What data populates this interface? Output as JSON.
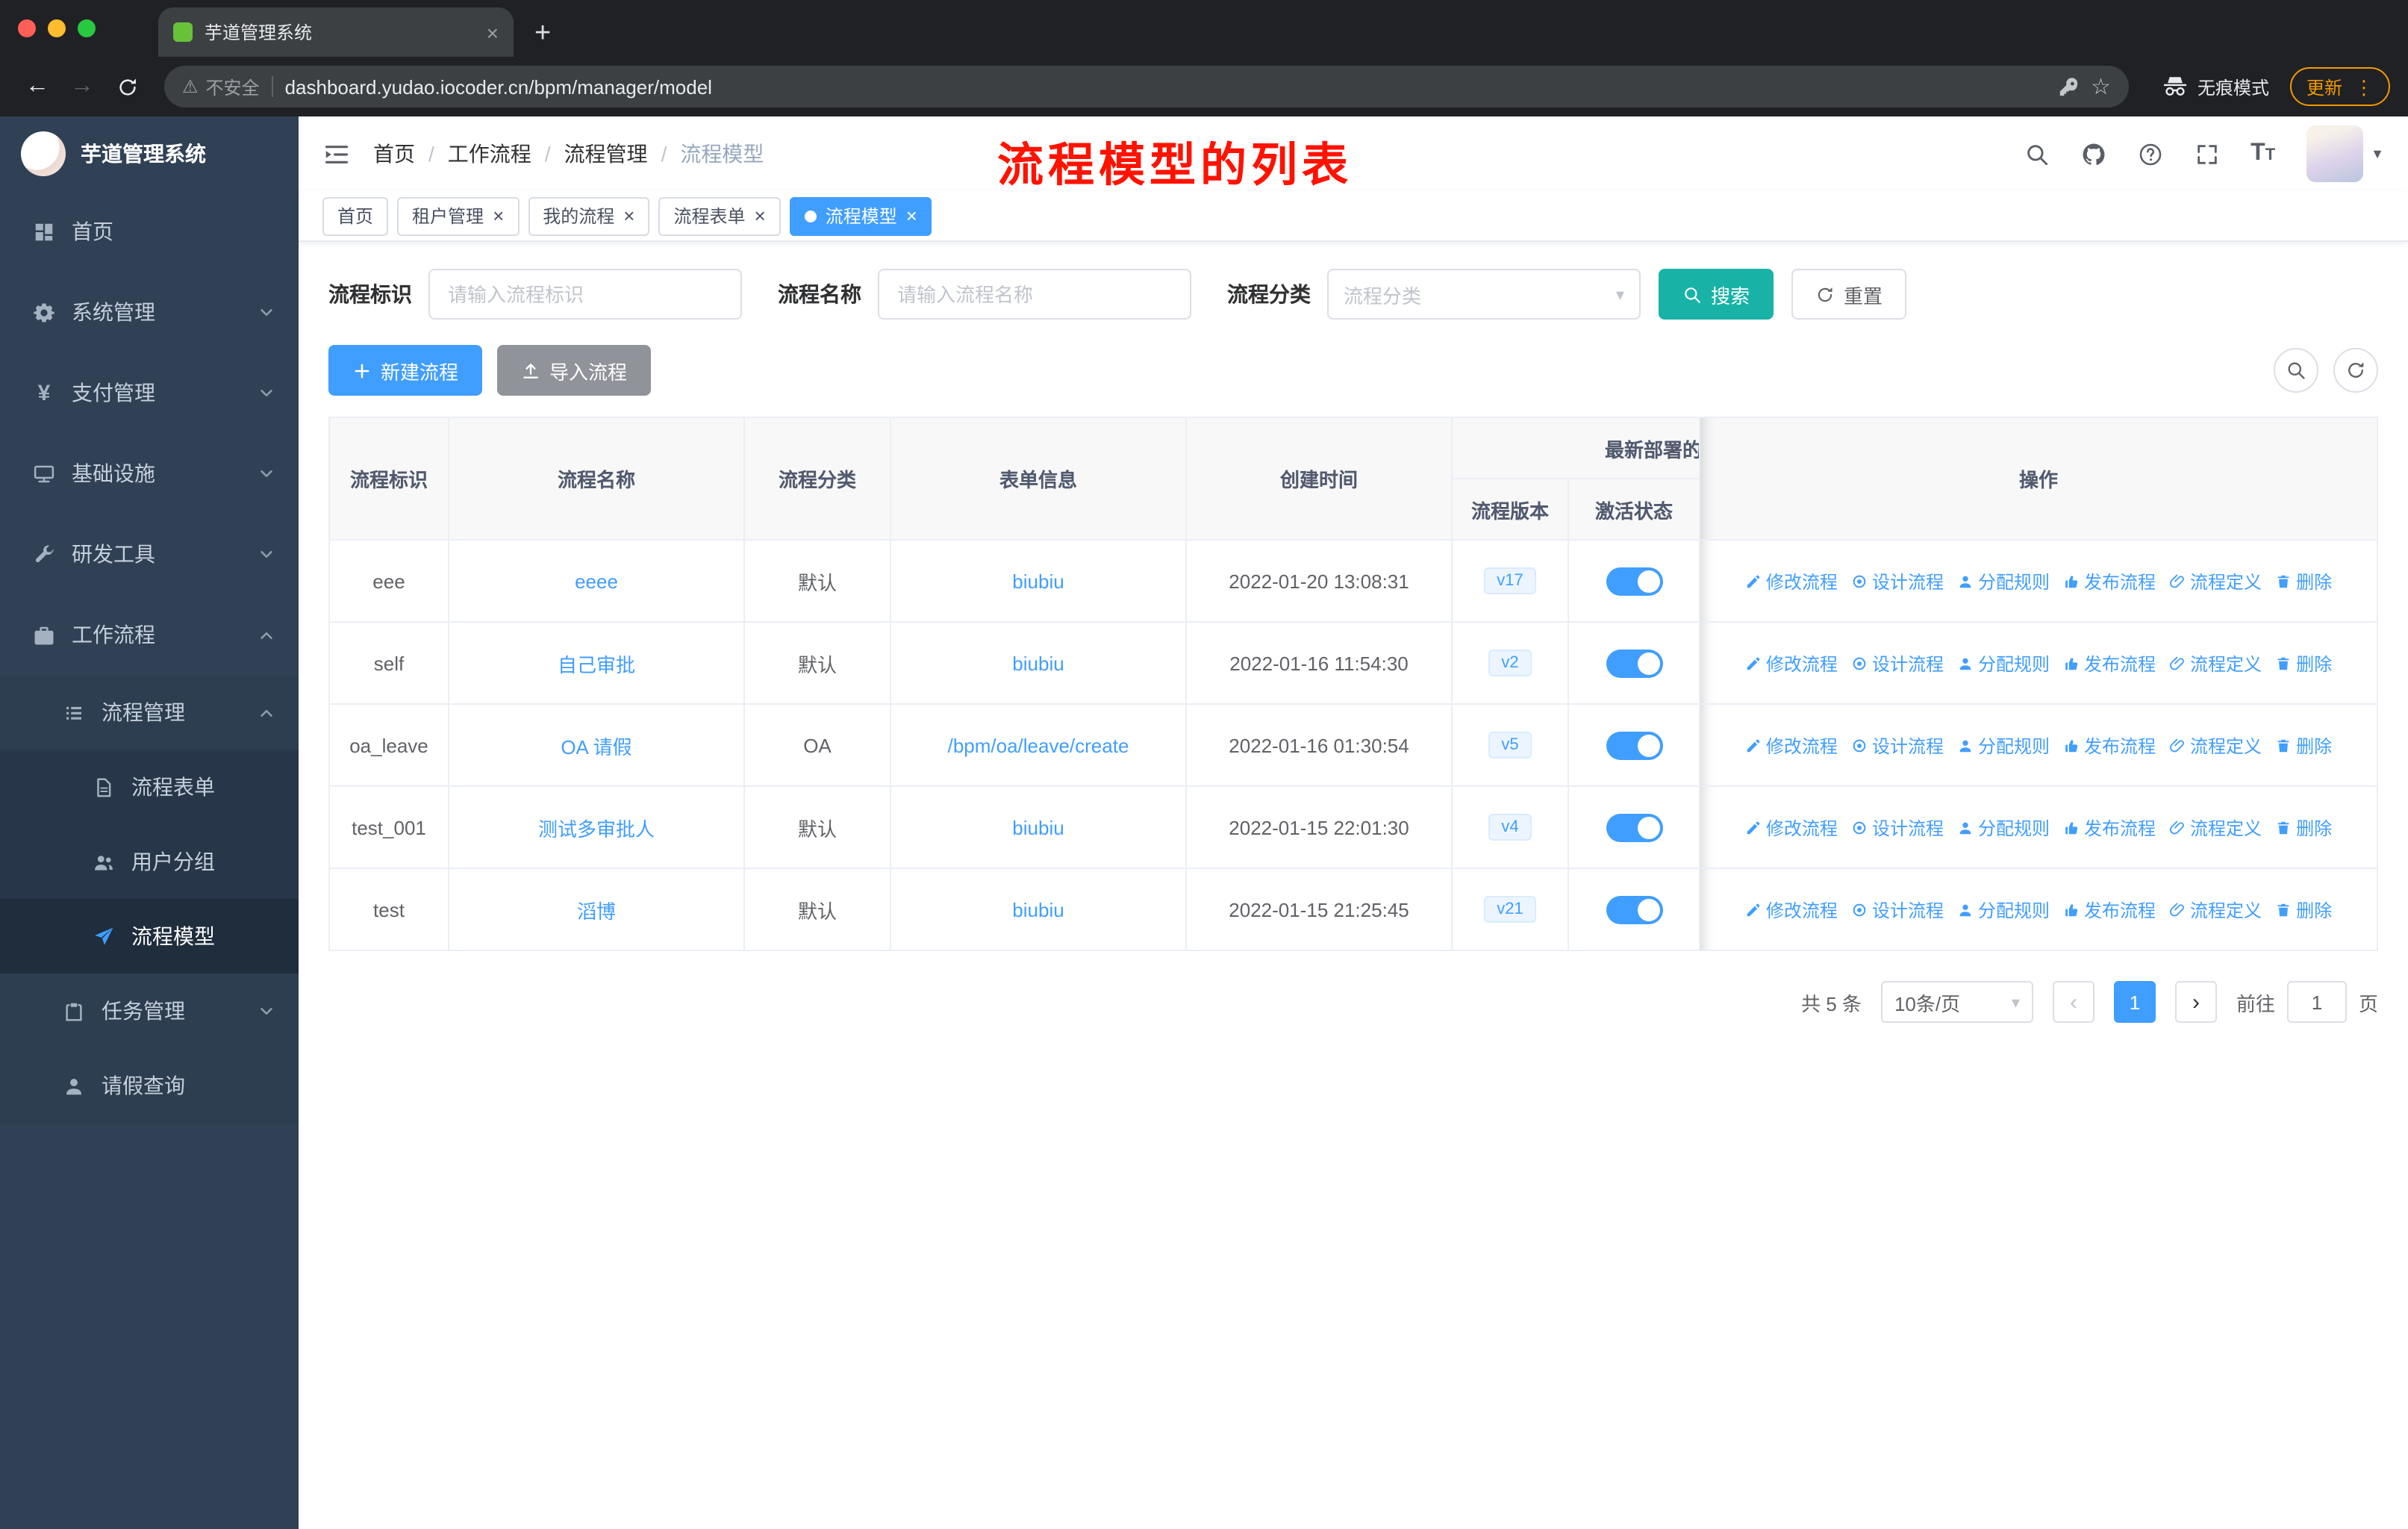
{
  "colors": {
    "primary": "#409eff",
    "search_button_teal": "#18b3a6",
    "annotation_red": "#ff1200",
    "sidebar_bg": "#304156",
    "toggle_on": "#409eff"
  },
  "browser": {
    "tab_title": "芋道管理系统",
    "security_label": "不安全",
    "url": "dashboard.yudao.iocoder.cn/bpm/manager/model",
    "incognito_label": "无痕模式",
    "update_label": "更新"
  },
  "sidebar": {
    "logo_title": "芋道管理系统",
    "menu": [
      {
        "label": "首页",
        "icon": "dashboard-icon"
      },
      {
        "label": "系统管理",
        "icon": "gear-icon"
      },
      {
        "label": "支付管理",
        "icon": "yen-icon"
      },
      {
        "label": "基础设施",
        "icon": "monitor-icon"
      },
      {
        "label": "研发工具",
        "icon": "wrench-icon"
      },
      {
        "label": "工作流程",
        "icon": "briefcase-icon"
      },
      {
        "label": "流程管理",
        "icon": "list-icon"
      },
      {
        "label": "流程表单",
        "icon": "document-icon"
      },
      {
        "label": "用户分组",
        "icon": "users-icon"
      },
      {
        "label": "流程模型",
        "icon": "send-icon"
      },
      {
        "label": "任务管理",
        "icon": "clipboard-icon"
      },
      {
        "label": "请假查询",
        "icon": "user-icon"
      }
    ]
  },
  "header": {
    "breadcrumbs": [
      "首页",
      "工作流程",
      "流程管理",
      "流程模型"
    ],
    "annotation": "流程模型的列表"
  },
  "tags": [
    {
      "label": "首页"
    },
    {
      "label": "租户管理"
    },
    {
      "label": "我的流程"
    },
    {
      "label": "流程表单"
    },
    {
      "label": "流程模型"
    }
  ],
  "filters": {
    "key_label": "流程标识",
    "key_placeholder": "请输入流程标识",
    "name_label": "流程名称",
    "name_placeholder": "请输入流程名称",
    "category_label": "流程分类",
    "category_placeholder": "流程分类",
    "search_label": "搜索",
    "reset_label": "重置"
  },
  "toolbar": {
    "create_label": "新建流程",
    "import_label": "导入流程"
  },
  "table": {
    "headers": {
      "key": "流程标识",
      "name": "流程名称",
      "category": "流程分类",
      "form": "表单信息",
      "create_time": "创建时间",
      "deploy_group": "最新部署的",
      "version": "流程版本",
      "active": "激活状态",
      "operation": "操作"
    },
    "actions": [
      "修改流程",
      "设计流程",
      "分配规则",
      "发布流程",
      "流程定义",
      "删除"
    ],
    "rows": [
      {
        "key": "eee",
        "name": "eeee",
        "category": "默认",
        "form": "biubiu",
        "create_time": "2022-01-20 13:08:31",
        "version": "v17",
        "active": true
      },
      {
        "key": "self",
        "name": "自己审批",
        "category": "默认",
        "form": "biubiu",
        "create_time": "2022-01-16 11:54:30",
        "version": "v2",
        "active": true
      },
      {
        "key": "oa_leave",
        "name": "OA 请假",
        "category": "OA",
        "form": "/bpm/oa/leave/create",
        "create_time": "2022-01-16 01:30:54",
        "version": "v5",
        "active": true
      },
      {
        "key": "test_001",
        "name": "测试多审批人",
        "category": "默认",
        "form": "biubiu",
        "create_time": "2022-01-15 22:01:30",
        "version": "v4",
        "active": true
      },
      {
        "key": "test",
        "name": "滔博",
        "category": "默认",
        "form": "biubiu",
        "create_time": "2022-01-15 21:25:45",
        "version": "v21",
        "active": true
      }
    ]
  },
  "pagination": {
    "total_label": "共 5 条",
    "page_size": "10条/页",
    "prev": "‹",
    "next": "›",
    "current_page": "1",
    "goto_label": "前往",
    "goto_value": "1",
    "unit_label": "页"
  },
  "icons": {
    "header_right": [
      "search-icon",
      "github-icon",
      "help-icon",
      "fullscreen-icon",
      "font-size-icon"
    ],
    "row_actions": [
      "edit-icon",
      "aim-icon",
      "user-icon",
      "thumb-up-icon",
      "paperclip-icon",
      "trash-icon"
    ]
  }
}
